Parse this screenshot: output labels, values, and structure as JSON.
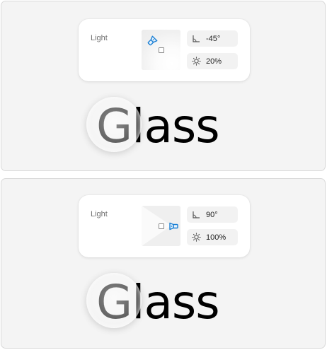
{
  "panels": [
    {
      "light_label": "Light",
      "angle_value": "-45°",
      "intensity_value": "20%",
      "preview_text": "Glass",
      "icons": {
        "bulb": "light-bulb-icon",
        "angle": "angle-icon",
        "intensity": "sun-icon"
      }
    },
    {
      "light_label": "Light",
      "angle_value": "90°",
      "intensity_value": "100%",
      "preview_text": "Glass",
      "icons": {
        "bulb": "light-bulb-icon",
        "angle": "angle-icon",
        "intensity": "sun-icon"
      }
    }
  ],
  "colors": {
    "accent": "#1a7fd4",
    "panel_bg": "#f4f4f4",
    "field_bg": "#f2f2f2",
    "text": "#000000"
  }
}
